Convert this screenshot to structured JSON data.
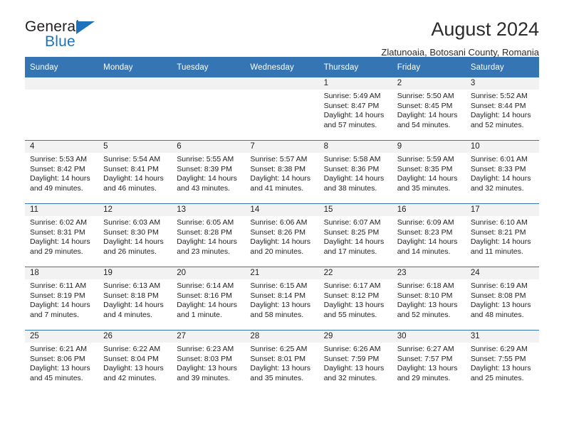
{
  "brand": {
    "name_top": "General",
    "name_bottom": "Blue",
    "accent_color": "#1c72bc"
  },
  "header": {
    "title": "August 2024",
    "subtitle": "Zlatunoaia, Botosani County, Romania"
  },
  "calendar": {
    "header_bg": "#3575b4",
    "daynum_bg": "#f2f2f2",
    "weekday_headers": [
      "Sunday",
      "Monday",
      "Tuesday",
      "Wednesday",
      "Thursday",
      "Friday",
      "Saturday"
    ],
    "labels": {
      "sunrise_prefix": "Sunrise:",
      "sunset_prefix": "Sunset:",
      "daylight_prefix": "Daylight:"
    },
    "weeks": [
      [
        {
          "day": "",
          "empty": true
        },
        {
          "day": "",
          "empty": true
        },
        {
          "day": "",
          "empty": true
        },
        {
          "day": "",
          "empty": true
        },
        {
          "day": "1",
          "sunrise": "Sunrise: 5:49 AM",
          "sunset": "Sunset: 8:47 PM",
          "daylight1": "Daylight: 14 hours",
          "daylight2": "and 57 minutes."
        },
        {
          "day": "2",
          "sunrise": "Sunrise: 5:50 AM",
          "sunset": "Sunset: 8:45 PM",
          "daylight1": "Daylight: 14 hours",
          "daylight2": "and 54 minutes."
        },
        {
          "day": "3",
          "sunrise": "Sunrise: 5:52 AM",
          "sunset": "Sunset: 8:44 PM",
          "daylight1": "Daylight: 14 hours",
          "daylight2": "and 52 minutes."
        }
      ],
      [
        {
          "day": "4",
          "sunrise": "Sunrise: 5:53 AM",
          "sunset": "Sunset: 8:42 PM",
          "daylight1": "Daylight: 14 hours",
          "daylight2": "and 49 minutes."
        },
        {
          "day": "5",
          "sunrise": "Sunrise: 5:54 AM",
          "sunset": "Sunset: 8:41 PM",
          "daylight1": "Daylight: 14 hours",
          "daylight2": "and 46 minutes."
        },
        {
          "day": "6",
          "sunrise": "Sunrise: 5:55 AM",
          "sunset": "Sunset: 8:39 PM",
          "daylight1": "Daylight: 14 hours",
          "daylight2": "and 43 minutes."
        },
        {
          "day": "7",
          "sunrise": "Sunrise: 5:57 AM",
          "sunset": "Sunset: 8:38 PM",
          "daylight1": "Daylight: 14 hours",
          "daylight2": "and 41 minutes."
        },
        {
          "day": "8",
          "sunrise": "Sunrise: 5:58 AM",
          "sunset": "Sunset: 8:36 PM",
          "daylight1": "Daylight: 14 hours",
          "daylight2": "and 38 minutes."
        },
        {
          "day": "9",
          "sunrise": "Sunrise: 5:59 AM",
          "sunset": "Sunset: 8:35 PM",
          "daylight1": "Daylight: 14 hours",
          "daylight2": "and 35 minutes."
        },
        {
          "day": "10",
          "sunrise": "Sunrise: 6:01 AM",
          "sunset": "Sunset: 8:33 PM",
          "daylight1": "Daylight: 14 hours",
          "daylight2": "and 32 minutes."
        }
      ],
      [
        {
          "day": "11",
          "sunrise": "Sunrise: 6:02 AM",
          "sunset": "Sunset: 8:31 PM",
          "daylight1": "Daylight: 14 hours",
          "daylight2": "and 29 minutes."
        },
        {
          "day": "12",
          "sunrise": "Sunrise: 6:03 AM",
          "sunset": "Sunset: 8:30 PM",
          "daylight1": "Daylight: 14 hours",
          "daylight2": "and 26 minutes."
        },
        {
          "day": "13",
          "sunrise": "Sunrise: 6:05 AM",
          "sunset": "Sunset: 8:28 PM",
          "daylight1": "Daylight: 14 hours",
          "daylight2": "and 23 minutes."
        },
        {
          "day": "14",
          "sunrise": "Sunrise: 6:06 AM",
          "sunset": "Sunset: 8:26 PM",
          "daylight1": "Daylight: 14 hours",
          "daylight2": "and 20 minutes."
        },
        {
          "day": "15",
          "sunrise": "Sunrise: 6:07 AM",
          "sunset": "Sunset: 8:25 PM",
          "daylight1": "Daylight: 14 hours",
          "daylight2": "and 17 minutes."
        },
        {
          "day": "16",
          "sunrise": "Sunrise: 6:09 AM",
          "sunset": "Sunset: 8:23 PM",
          "daylight1": "Daylight: 14 hours",
          "daylight2": "and 14 minutes."
        },
        {
          "day": "17",
          "sunrise": "Sunrise: 6:10 AM",
          "sunset": "Sunset: 8:21 PM",
          "daylight1": "Daylight: 14 hours",
          "daylight2": "and 11 minutes."
        }
      ],
      [
        {
          "day": "18",
          "sunrise": "Sunrise: 6:11 AM",
          "sunset": "Sunset: 8:19 PM",
          "daylight1": "Daylight: 14 hours",
          "daylight2": "and 7 minutes."
        },
        {
          "day": "19",
          "sunrise": "Sunrise: 6:13 AM",
          "sunset": "Sunset: 8:18 PM",
          "daylight1": "Daylight: 14 hours",
          "daylight2": "and 4 minutes."
        },
        {
          "day": "20",
          "sunrise": "Sunrise: 6:14 AM",
          "sunset": "Sunset: 8:16 PM",
          "daylight1": "Daylight: 14 hours",
          "daylight2": "and 1 minute."
        },
        {
          "day": "21",
          "sunrise": "Sunrise: 6:15 AM",
          "sunset": "Sunset: 8:14 PM",
          "daylight1": "Daylight: 13 hours",
          "daylight2": "and 58 minutes."
        },
        {
          "day": "22",
          "sunrise": "Sunrise: 6:17 AM",
          "sunset": "Sunset: 8:12 PM",
          "daylight1": "Daylight: 13 hours",
          "daylight2": "and 55 minutes."
        },
        {
          "day": "23",
          "sunrise": "Sunrise: 6:18 AM",
          "sunset": "Sunset: 8:10 PM",
          "daylight1": "Daylight: 13 hours",
          "daylight2": "and 52 minutes."
        },
        {
          "day": "24",
          "sunrise": "Sunrise: 6:19 AM",
          "sunset": "Sunset: 8:08 PM",
          "daylight1": "Daylight: 13 hours",
          "daylight2": "and 48 minutes."
        }
      ],
      [
        {
          "day": "25",
          "sunrise": "Sunrise: 6:21 AM",
          "sunset": "Sunset: 8:06 PM",
          "daylight1": "Daylight: 13 hours",
          "daylight2": "and 45 minutes."
        },
        {
          "day": "26",
          "sunrise": "Sunrise: 6:22 AM",
          "sunset": "Sunset: 8:04 PM",
          "daylight1": "Daylight: 13 hours",
          "daylight2": "and 42 minutes."
        },
        {
          "day": "27",
          "sunrise": "Sunrise: 6:23 AM",
          "sunset": "Sunset: 8:03 PM",
          "daylight1": "Daylight: 13 hours",
          "daylight2": "and 39 minutes."
        },
        {
          "day": "28",
          "sunrise": "Sunrise: 6:25 AM",
          "sunset": "Sunset: 8:01 PM",
          "daylight1": "Daylight: 13 hours",
          "daylight2": "and 35 minutes."
        },
        {
          "day": "29",
          "sunrise": "Sunrise: 6:26 AM",
          "sunset": "Sunset: 7:59 PM",
          "daylight1": "Daylight: 13 hours",
          "daylight2": "and 32 minutes."
        },
        {
          "day": "30",
          "sunrise": "Sunrise: 6:27 AM",
          "sunset": "Sunset: 7:57 PM",
          "daylight1": "Daylight: 13 hours",
          "daylight2": "and 29 minutes."
        },
        {
          "day": "31",
          "sunrise": "Sunrise: 6:29 AM",
          "sunset": "Sunset: 7:55 PM",
          "daylight1": "Daylight: 13 hours",
          "daylight2": "and 25 minutes."
        }
      ]
    ]
  }
}
